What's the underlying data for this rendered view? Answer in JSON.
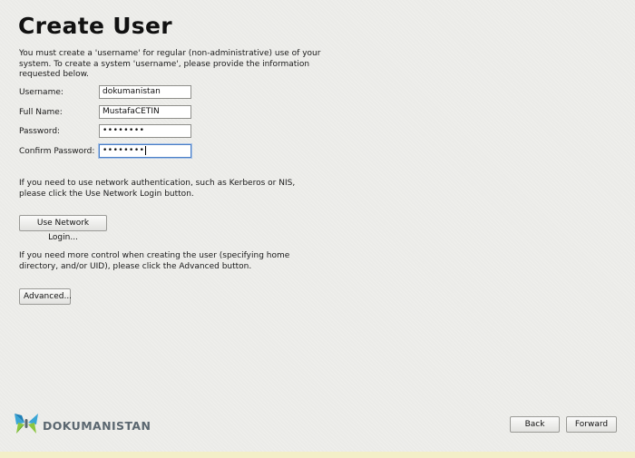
{
  "page": {
    "title": "Create User",
    "intro": "You must create a 'username' for regular (non-administrative) use of your system.  To create a system 'username', please provide the information requested below."
  },
  "form": {
    "username_label": "Username:",
    "username_value": "dokumanistan",
    "fullname_label": "Full Name:",
    "fullname_value": "MustafaCETIN",
    "password_label": "Password:",
    "password_mask": "••••••••",
    "confirm_label": "Confirm Password:",
    "confirm_mask": "••••••••"
  },
  "network": {
    "text": "If you need to use network authentication, such as Kerberos or NIS, please click the Use Network Login button.",
    "button_label": "Use Network Login..."
  },
  "advanced": {
    "text": "If you need more control when creating the user (specifying home directory, and/or UID), please click the Advanced button.",
    "button_label": "Advanced..."
  },
  "footer": {
    "logo_text": "DOKUMANISTAN",
    "logo_icon": "butterfly-logo-icon",
    "back_label": "Back",
    "forward_label": "Forward"
  }
}
